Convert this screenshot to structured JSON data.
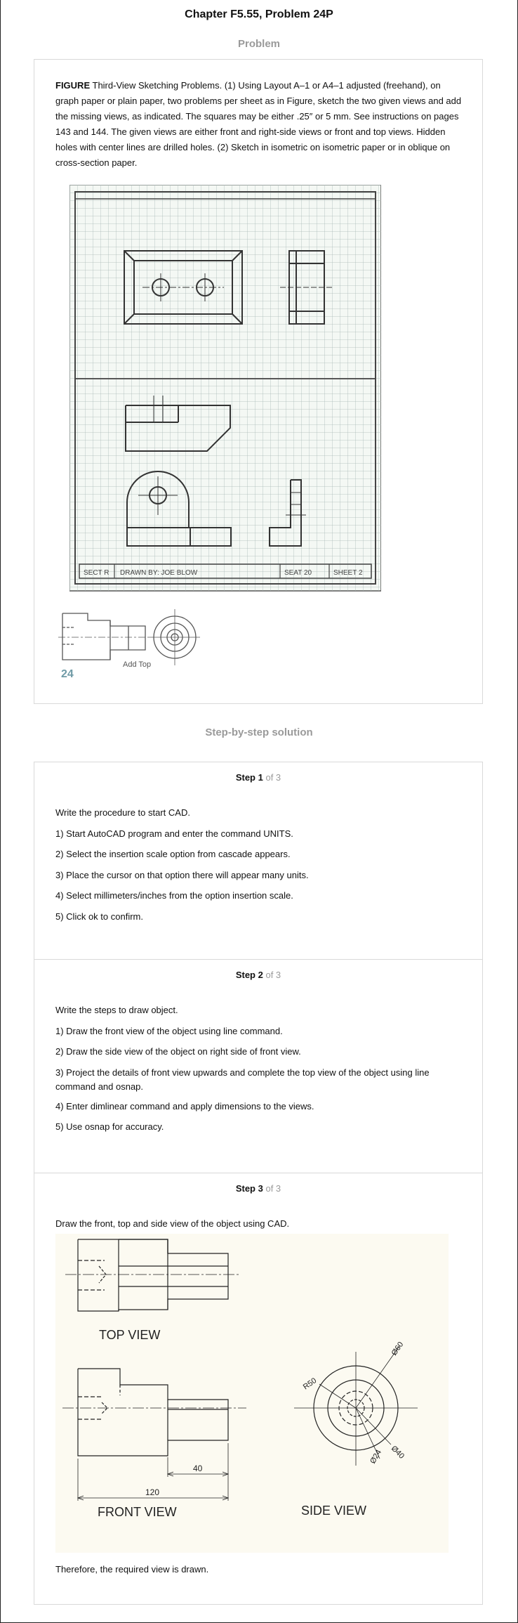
{
  "header": {
    "title": "Chapter F5.55, Problem 24P"
  },
  "problem": {
    "section_label": "Problem",
    "figure_label": "FIGURE",
    "text": " Third-View Sketching Problems. (1) Using Layout A–1 or A4–1 adjusted (freehand), on graph paper or plain paper, two problems per sheet as in Figure, sketch the two given views and add the missing views, as indicated. The squares may be either .25″ or 5 mm. See instructions on pages 143 and 144. The given views are either front and right-side views or front and top views. Hidden holes with center lines are drilled holes. (2) Sketch in isometric on isometric paper or in oblique on cross-section paper.",
    "title_block": {
      "sect": "SECT R",
      "drawn_by": "DRAWN BY: JOE BLOW",
      "seat": "SEAT 20",
      "sheet": "SHEET 2"
    },
    "problem_number": "24",
    "caption": "Add Top"
  },
  "solution": {
    "section_label": "Step-by-step solution",
    "steps": [
      {
        "label": "Step 1",
        "of": "of 3",
        "lines": [
          "Write the procedure to start CAD.",
          "1) Start AutoCAD program and enter the command UNITS.",
          "2) Select the insertion scale option from cascade appears.",
          "3) Place the cursor on that option there will appear many units.",
          "4) Select millimeters/inches from the option insertion scale.",
          "5) Click ok to confirm."
        ]
      },
      {
        "label": "Step 2",
        "of": "of 3",
        "lines": [
          "Write the steps to draw object.",
          "1) Draw the front view of the object using line command.",
          "2) Draw the side view of the object on right side of front view.",
          "3) Project the details of front view upwards and complete the top view of the object using line command and osnap.",
          "4) Enter dimlinear command and apply dimensions to the views.",
          "5) Use osnap for accuracy."
        ]
      },
      {
        "label": "Step 3",
        "of": "of 3",
        "intro": "Draw the front, top and side view of the object using CAD.",
        "conclusion": "Therefore, the required view is drawn.",
        "drawing": {
          "top_view": "TOP VIEW",
          "front_view": "FRONT VIEW",
          "side_view": "SIDE VIEW",
          "dim_40": "40",
          "dim_120": "120",
          "r50": "R50",
          "d60": "Ø60",
          "d40": "Ø40",
          "d24": "Ø24"
        }
      }
    ]
  }
}
